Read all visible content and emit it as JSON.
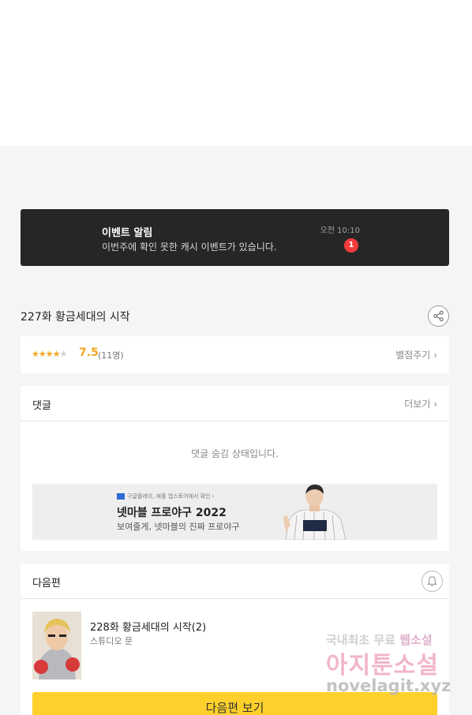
{
  "notice": {
    "title": "이벤트 알림",
    "message": "이번주에 확인 못한 캐시 이벤트가 있습니다.",
    "time": "오전 10:10",
    "badge_count": "1"
  },
  "episode": {
    "title": "227화 황금세대의 시작",
    "share_icon": "share-icon"
  },
  "rating": {
    "stars_filled": 4,
    "stars_total": 5,
    "score": "7.5",
    "count": "(11명)",
    "rate_link": "별점주기"
  },
  "comments": {
    "header": "댓글",
    "more": "더보기",
    "hidden_message": "댓글 숨김 상태입니다."
  },
  "ad": {
    "small_text": "구글플레이, 애플 앱스토어에서 확인 ›",
    "title": "넷마블 프로야구 2022",
    "subtitle": "보여줄게, 넷마블의 진짜 프로야구"
  },
  "next_episode": {
    "header": "다음편",
    "title": "228화 황금세대의 시작(2)",
    "author": "스튜디오 문",
    "button": "다음편 보기",
    "bell_icon": "bell-icon"
  },
  "watermark": {
    "line1_a": "국내최초 무료 ",
    "line1_b": "웹소설",
    "line2": "아지툰소설",
    "line3": "novelagit.xyz"
  },
  "colors": {
    "accent": "#ffd02b",
    "star": "#f5a623",
    "badge": "#f43b3b",
    "notice_bg": "#262626"
  }
}
